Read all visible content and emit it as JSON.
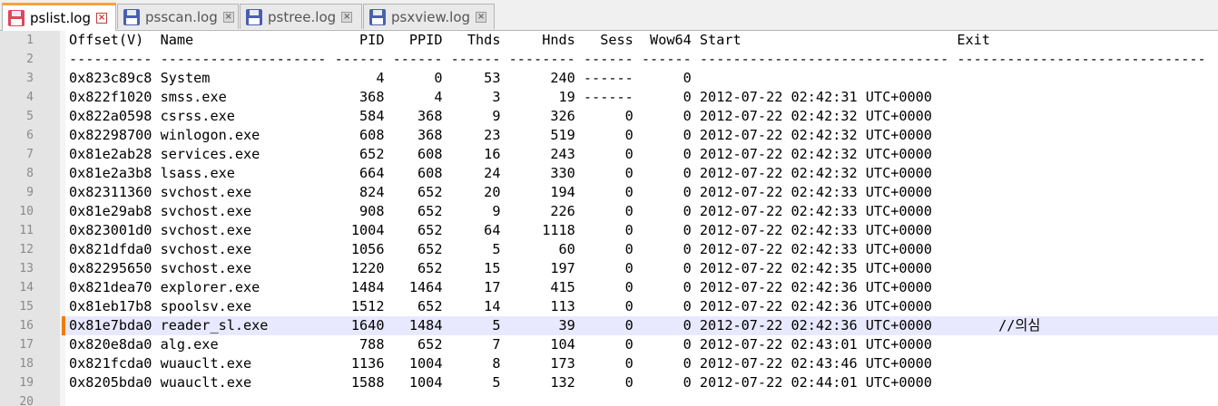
{
  "tabs": [
    {
      "label": "pslist.log",
      "active": true,
      "icon": "floppy-disk-icon",
      "icon_color": "#e0465a"
    },
    {
      "label": "psscan.log",
      "active": false,
      "icon": "floppy-disk-icon",
      "icon_color": "#4a5fb0"
    },
    {
      "label": "pstree.log",
      "active": false,
      "icon": "floppy-disk-icon",
      "icon_color": "#4a5fb0"
    },
    {
      "label": "psxview.log",
      "active": false,
      "icon": "floppy-disk-icon",
      "icon_color": "#4a5fb0"
    }
  ],
  "editor": {
    "current_line": 16,
    "changed_lines": [
      16
    ],
    "highlight_color": "#e8e8ff",
    "lines": [
      "Offset(V)  Name                    PID   PPID   Thds     Hnds   Sess  Wow64 Start                          Exit",
      "---------- -------------------- ------ ------ ------ -------- ------ ------ ------------------------------ ------------------------------",
      "0x823c89c8 System                    4      0     53      240 ------      0",
      "0x822f1020 smss.exe                368      4      3       19 ------      0 2012-07-22 02:42:31 UTC+0000",
      "0x822a0598 csrss.exe               584    368      9      326      0      0 2012-07-22 02:42:32 UTC+0000",
      "0x82298700 winlogon.exe            608    368     23      519      0      0 2012-07-22 02:42:32 UTC+0000",
      "0x81e2ab28 services.exe            652    608     16      243      0      0 2012-07-22 02:42:32 UTC+0000",
      "0x81e2a3b8 lsass.exe               664    608     24      330      0      0 2012-07-22 02:42:32 UTC+0000",
      "0x82311360 svchost.exe             824    652     20      194      0      0 2012-07-22 02:42:33 UTC+0000",
      "0x81e29ab8 svchost.exe             908    652      9      226      0      0 2012-07-22 02:42:33 UTC+0000",
      "0x823001d0 svchost.exe            1004    652     64     1118      0      0 2012-07-22 02:42:33 UTC+0000",
      "0x821dfda0 svchost.exe            1056    652      5       60      0      0 2012-07-22 02:42:33 UTC+0000",
      "0x82295650 svchost.exe            1220    652     15      197      0      0 2012-07-22 02:42:35 UTC+0000",
      "0x821dea70 explorer.exe           1484   1464     17      415      0      0 2012-07-22 02:42:36 UTC+0000",
      "0x81eb17b8 spoolsv.exe            1512    652     14      113      0      0 2012-07-22 02:42:36 UTC+0000",
      "0x81e7bda0 reader_sl.exe          1640   1484      5       39      0      0 2012-07-22 02:42:36 UTC+0000        //의심",
      "0x820e8da0 alg.exe                 788    652      7      104      0      0 2012-07-22 02:43:01 UTC+0000",
      "0x821fcda0 wuauclt.exe            1136   1004      8      173      0      0 2012-07-22 02:43:46 UTC+0000",
      "0x8205bda0 wuauclt.exe            1588   1004      5      132      0      0 2012-07-22 02:44:01 UTC+0000",
      ""
    ]
  }
}
